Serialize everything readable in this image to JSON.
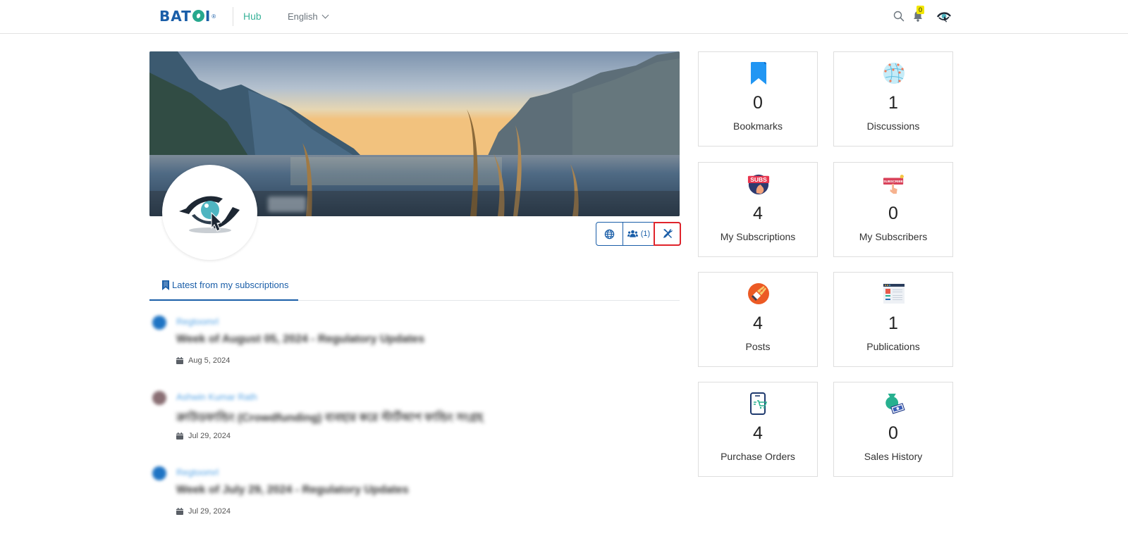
{
  "topnav": {
    "logo_text": "BAT",
    "logo_text_end": "I",
    "logo_reg": "®",
    "hub_label": "Hub",
    "language": "English",
    "notification_count": "0"
  },
  "profile": {
    "name_blurred": "Name",
    "actions": {
      "members_count": "(1)"
    }
  },
  "tabs": [
    {
      "label": "Latest from my subscriptions",
      "active": true
    }
  ],
  "feed": [
    {
      "author": "Regtoomrl",
      "title": "Week of August 05, 2024 - Regulatory Updates",
      "date": "Aug 5, 2024",
      "avatar_color": "#1f74c4"
    },
    {
      "author": "Ashwin Kumar Rath",
      "title": "ক্রাউডফান্ডিং (Crowdfunding) ব্যবহার করে স্টার্টআপ ফান্ডিং সংগ্রহ",
      "date": "Jul 29, 2024",
      "avatar_color": "#8a6f74"
    },
    {
      "author": "Regtoomrl",
      "title": "Week of July 29, 2024 - Regulatory Updates",
      "date": "Jul 29, 2024",
      "avatar_color": "#1f74c4"
    }
  ],
  "stats": [
    {
      "icon": "bookmark-icon",
      "value": "0",
      "label": "Bookmarks"
    },
    {
      "icon": "discussions-network-icon",
      "value": "1",
      "label": "Discussions"
    },
    {
      "icon": "subscriptions-icon",
      "value": "4",
      "label": "My Subscriptions"
    },
    {
      "icon": "subscribers-icon",
      "value": "0",
      "label": "My Subscribers"
    },
    {
      "icon": "posts-pen-icon",
      "value": "4",
      "label": "Posts"
    },
    {
      "icon": "publications-icon",
      "value": "1",
      "label": "Publications"
    },
    {
      "icon": "purchase-orders-icon",
      "value": "4",
      "label": "Purchase Orders"
    },
    {
      "icon": "sales-history-icon",
      "value": "0",
      "label": "Sales History"
    }
  ],
  "stat_icons": {
    "subs_badge_text": "SUBS",
    "subscribe_badge_text": "SUBSCRIBE"
  },
  "colors": {
    "brand_blue": "#1a5ea8",
    "brand_green": "#3bb39a",
    "highlight_red": "#e0242b",
    "badge_yellow": "#f2e600"
  }
}
